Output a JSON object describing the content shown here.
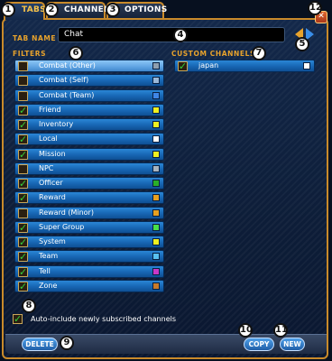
{
  "tabs": [
    {
      "label": "TABS",
      "callout": "1",
      "active": true
    },
    {
      "label": "CHANNELS",
      "callout": "2",
      "active": false
    },
    {
      "label": "OPTIONS",
      "callout": "3",
      "active": false
    }
  ],
  "tab_name": {
    "label": "TAB NAME",
    "value": "Chat",
    "callout": "4"
  },
  "arrows_callout": "5",
  "filters": {
    "label": "FILTERS",
    "callout": "6",
    "items": [
      {
        "label": "Combat (Other)",
        "checked": false,
        "color": "#8f9fb0",
        "selected": true
      },
      {
        "label": "Combat (Self)",
        "checked": false,
        "color": "#9ab8d8",
        "selected": false
      },
      {
        "label": "Combat (Team)",
        "checked": false,
        "color": "#3f86e6",
        "selected": false
      },
      {
        "label": "Friend",
        "checked": true,
        "color": "#f0f020",
        "selected": false
      },
      {
        "label": "Inventory",
        "checked": true,
        "color": "#f0f020",
        "selected": false
      },
      {
        "label": "Local",
        "checked": true,
        "color": "#ffffff",
        "selected": false
      },
      {
        "label": "Mission",
        "checked": true,
        "color": "#f0f020",
        "selected": false
      },
      {
        "label": "NPC",
        "checked": false,
        "color": "#a8b4c0",
        "selected": false
      },
      {
        "label": "Officer",
        "checked": true,
        "color": "#2ab02a",
        "selected": false
      },
      {
        "label": "Reward",
        "checked": true,
        "color": "#e8a020",
        "selected": false
      },
      {
        "label": "Reward (Minor)",
        "checked": false,
        "color": "#e8a020",
        "selected": false
      },
      {
        "label": "Super Group",
        "checked": true,
        "color": "#48e048",
        "selected": false
      },
      {
        "label": "System",
        "checked": true,
        "color": "#f0f020",
        "selected": false
      },
      {
        "label": "Team",
        "checked": true,
        "color": "#58c0f0",
        "selected": false
      },
      {
        "label": "Tell",
        "checked": true,
        "color": "#c838c8",
        "selected": false
      },
      {
        "label": "Zone",
        "checked": true,
        "color": "#c87a2a",
        "selected": false
      }
    ]
  },
  "custom_channels": {
    "label": "CUSTOM CHANNELS",
    "callout": "7",
    "items": [
      {
        "label": "japan",
        "checked": true,
        "color": "#ffffff",
        "selected": false
      }
    ]
  },
  "auto_include": {
    "label": "Auto-include newly subscribed channels",
    "checked": true,
    "callout": "8"
  },
  "buttons": {
    "delete": {
      "label": "DELETE",
      "callout": "9"
    },
    "copy": {
      "label": "COPY",
      "callout": "10"
    },
    "new": {
      "label": "NEW",
      "callout": "11"
    }
  },
  "close": {
    "glyph": "✕",
    "callout": "12"
  },
  "check_glyph": "✓"
}
